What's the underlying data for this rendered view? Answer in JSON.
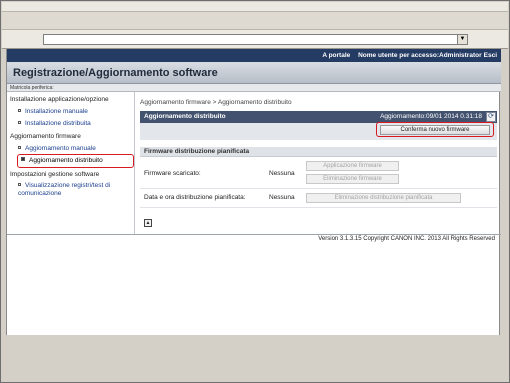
{
  "topnav": {
    "portal_link": "A portale",
    "user_label": "Nome utente per accesso:Administrator",
    "logout_link": "Esci"
  },
  "header": {
    "title": "Registrazione/Aggiornamento software"
  },
  "device_serial_label": "Matricola periferica:",
  "sidebar": {
    "section1": "Installazione applicazione/opzione",
    "item_manual_install": "Installazione manuale",
    "item_distributed_install": "Installazione distribuita",
    "section2": "Aggiornamento firmware",
    "item_manual_update": "Aggiornamento manuale",
    "item_distributed_update": "Aggiornamento distribuito",
    "section3": "Impostazioni gestione software",
    "item_log_view": "Visualizzazione registri/test di comunicazione"
  },
  "main": {
    "breadcrumb": "Aggiornamento firmware > Aggiornamento distribuito",
    "panel_title": "Aggiornamento distribuito",
    "panel_updated": "Aggiornamento:09/01 2014 0.31:18",
    "confirm_button": "Conferma nuovo firmware",
    "section_title": "Firmware distribuzione pianificata",
    "row1_label": "Firmware scaricato:",
    "row1_value": "Nessuna",
    "apply_button": "Applicazione firmware",
    "delete_fw_button": "Eliminazione firmware",
    "row2_label": "Data e ora distribuzione pianificata:",
    "row2_value": "Nessuna",
    "delete_sched_button": "Eliminazione distribuzione pianificata"
  },
  "footer": {
    "copyright": "Version 3.1.3.15 Copyright CANON INC. 2013 All Rights Reserved"
  },
  "colors": {
    "accent": "#243b63",
    "highlight": "#d71920"
  }
}
